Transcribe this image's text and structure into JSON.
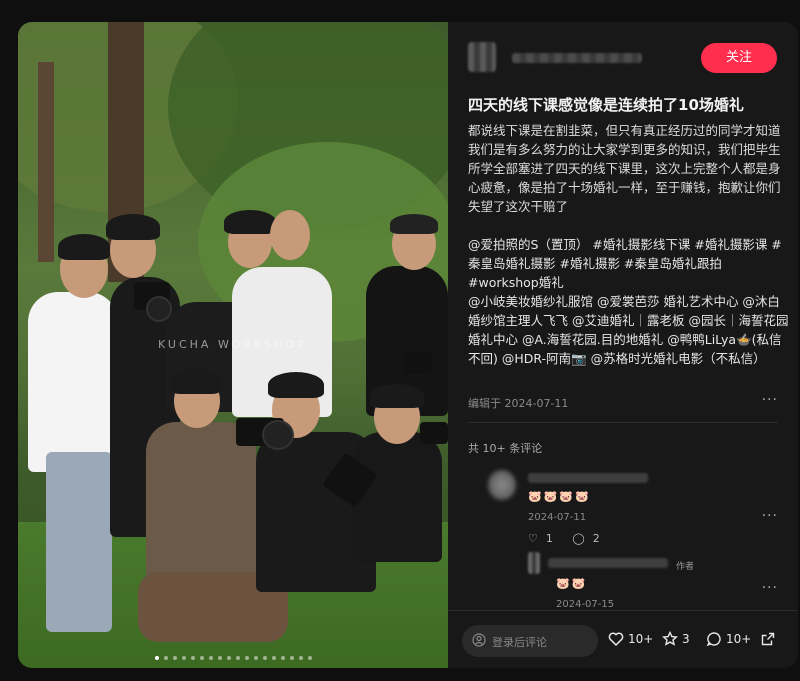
{
  "post": {
    "title": "四天的线下课感觉像是连续拍了10场婚礼",
    "body": "都说线下课是在割韭菜，但只有真正经历过的同学才知道我们是有多么努力的让大家学到更多的知识，我们把毕生所学全部塞进了四天的线下课里，这次上完整个人都是身心疲惫，像是拍了十场婚礼一样，至于赚钱，抱歉让你们失望了这次干赔了",
    "tags": "@爱拍照的S（置顶） #婚礼摄影线下课 #婚礼摄影课 #秦皇岛婚礼摄影 #婚礼摄影 #秦皇岛婚礼跟拍 #workshop婚礼",
    "mentions": "@小岐美妆婚纱礼服馆 @爱裳芭莎 婚礼艺术中心 @沐白婚纱馆主理人飞飞 @艾迪婚礼｜露老板 @园长｜海誓花园婚礼中心 @A.海誓花园.目的地婚礼 @鸭鸭LiLya🍲(私信不回) @HDR-阿南📷 @苏格时光婚礼电影（不私信）",
    "date": "编辑于 2024-07-11"
  },
  "header": {
    "follow_label": "关注"
  },
  "photo": {
    "watermark": "KUCHA WORKSHOP",
    "slide_count": 18,
    "active_slide": 0
  },
  "comments": {
    "count_label": "共 10+ 条评论",
    "first": {
      "emoji": "🐷🐷🐷🐷",
      "date": "2024-07-11",
      "likes": "1",
      "replies": "2"
    },
    "reply": {
      "badge": "作者",
      "emoji": "🐷🐷",
      "date": "2024-07-15"
    }
  },
  "bottom_bar": {
    "placeholder": "登录后评论",
    "likes": "10+",
    "stars": "3",
    "comments": "10+"
  },
  "colors": {
    "accent": "#ff2e4d",
    "panel": "#181818"
  }
}
